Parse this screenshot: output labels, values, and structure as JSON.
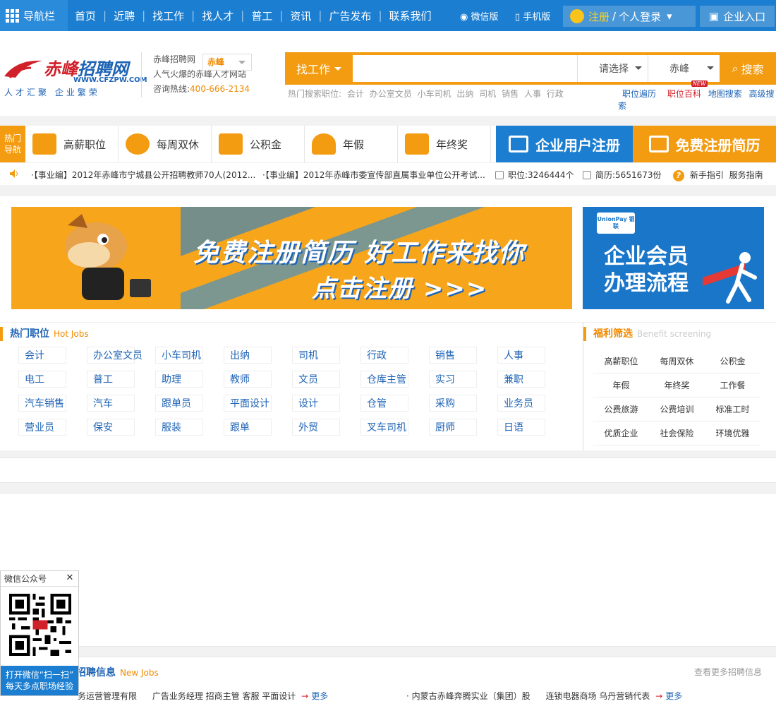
{
  "topbar": {
    "nav_label": "导航栏",
    "menu": [
      "首页",
      "近聘",
      "找工作",
      "找人才",
      "普工",
      "资讯",
      "广告发布",
      "联系我们"
    ],
    "wechat": "微信版",
    "mobile": "手机版",
    "register": "注册",
    "slash": "/",
    "login": "个人登录",
    "enterprise": "企业入口"
  },
  "header": {
    "logo_title_a": "赤峰",
    "logo_title_b": "招聘网",
    "logo_url": "WWW.CFZPW.COM",
    "logo_slogan": "人才汇聚 企业繁荣",
    "site_name": "赤峰招聘网",
    "city": "赤峰",
    "tagline": "人气火爆的赤峰人才网站",
    "hotline_label": "咨询热线:",
    "hotline": "400-666-2134"
  },
  "search": {
    "type": "找工作",
    "placeholder": "",
    "select1": "请选择",
    "select2": "赤峰",
    "button": "搜索",
    "hot_label": "热门搜索职位:",
    "hot": [
      "会计",
      "办公室文员",
      "小车司机",
      "出纳",
      "司机",
      "销售",
      "人事",
      "行政"
    ],
    "links": [
      "职位遍历",
      "职位百科",
      "地图搜索",
      "高级搜索"
    ],
    "new_badge": "NEW"
  },
  "welfare_bar": {
    "label": "热门导航",
    "items": [
      "高薪职位",
      "每周双休",
      "公积金",
      "年假",
      "年终奖"
    ],
    "enterprise_register": "企业用户注册",
    "free_resume": "免费注册简历"
  },
  "news": {
    "item1": "·【事业编】2012年赤峰市宁城县公开招聘教师70人(2012...",
    "item2": "·【事业编】2012年赤峰市委宣传部直属事业单位公开考试...",
    "jobs": "职位:3246444个",
    "resumes": "简历:5651673份",
    "guide": "新手指引",
    "service": "服务指南"
  },
  "banners": {
    "main_line1": "免费注册简历 好工作来找你",
    "main_line2": "点击注册 >>>",
    "side_logo": "UnionPay 银联",
    "side_line1": "企业会员",
    "side_line2": "办理流程"
  },
  "hotjobs": {
    "title": "热门职位",
    "subtitle": "Hot Jobs",
    "items": [
      "会计",
      "办公室文员",
      "小车司机",
      "出纳",
      "司机",
      "行政",
      "销售",
      "人事",
      "电工",
      "普工",
      "助理",
      "教师",
      "文员",
      "仓库主管",
      "实习",
      "兼职",
      "汽车销售",
      "汽车",
      "跟单员",
      "平面设计",
      "设计",
      "仓管",
      "采购",
      "业务员",
      "营业员",
      "保安",
      "服装",
      "跟单",
      "外贸",
      "叉车司机",
      "厨师",
      "日语"
    ]
  },
  "wfilter": {
    "title": "福利筛选",
    "subtitle": "Benefit screening",
    "items": [
      "高薪职位",
      "每周双休",
      "公积金",
      "年假",
      "年终奖",
      "工作餐",
      "公费旅游",
      "公费培训",
      "标准工时",
      "优质企业",
      "社会保险",
      "环境优雅"
    ]
  },
  "newjobs": {
    "title": "招聘信息",
    "subtitle": "New Jobs",
    "more": "查看更多招聘信息",
    "row1_company": "务运营管理有限",
    "row1_jobs": "广告业务经理 招商主管 客服 平面设计",
    "row2_company": "· 内蒙古赤峰奔腾实业（集团）股",
    "row2_jobs": "连锁电器商场 乌丹营销代表",
    "more_label": "更多",
    "arrow": "→"
  },
  "wxfloat": {
    "title": "微信公众号",
    "close": "✕",
    "line1": "打开微信“扫一扫”",
    "line2": "每天多点职场经验"
  }
}
